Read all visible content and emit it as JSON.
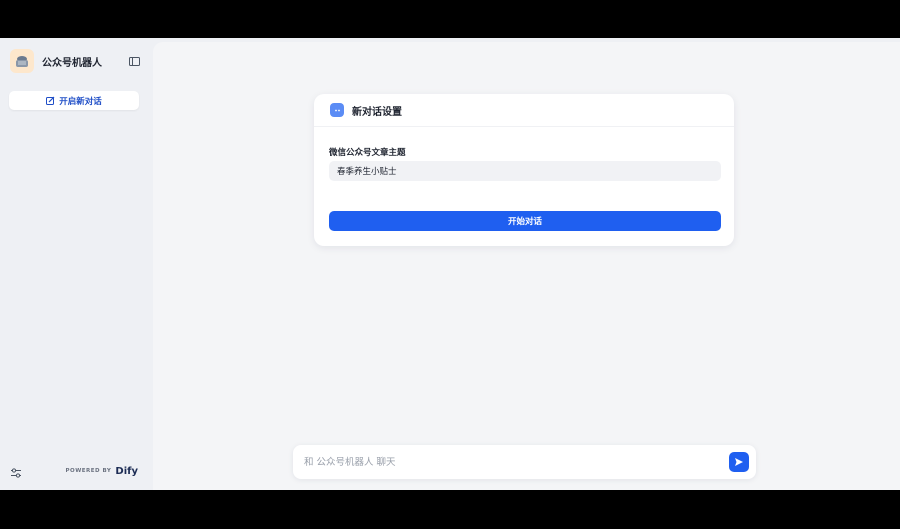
{
  "app": {
    "name": "公众号机器人"
  },
  "sidebar": {
    "new_chat_label": "开启新对话"
  },
  "footer": {
    "powered_by": "POWERED BY",
    "brand": "Dify"
  },
  "dialog": {
    "title": "新对话设置",
    "field_label": "微信公众号文章主题",
    "field_value": "春季养生小贴士",
    "start_button": "开始对话"
  },
  "chat": {
    "placeholder": "和 公众号机器人 聊天"
  },
  "colors": {
    "accent": "#1f5ff0",
    "background": "#eef0f4",
    "card": "#ffffff"
  }
}
